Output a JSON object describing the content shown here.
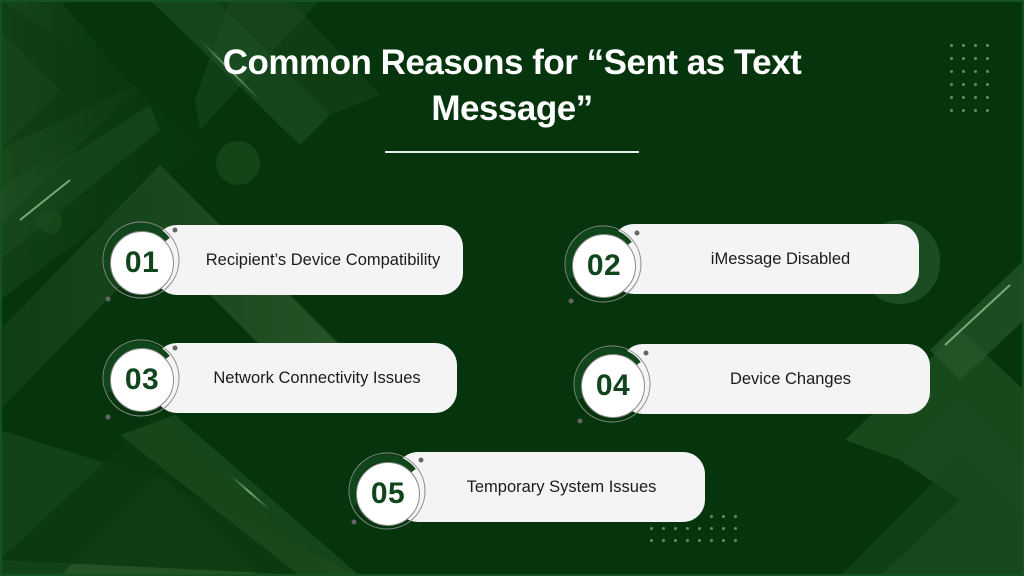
{
  "slide": {
    "title": "Common Reasons for “Sent as Text Message”",
    "colors": {
      "background": "#06350d",
      "accent_green": "#11461d",
      "pill_fill": "#f4f4f4",
      "title_text": "#ffffff"
    }
  },
  "reasons": [
    {
      "number": "01",
      "label": "Recipient’s Device Compatibility"
    },
    {
      "number": "02",
      "label": "iMessage Disabled"
    },
    {
      "number": "03",
      "label": "Network Connectivity Issues"
    },
    {
      "number": "04",
      "label": "Device Changes"
    },
    {
      "number": "05",
      "label": "Temporary System Issues"
    }
  ]
}
